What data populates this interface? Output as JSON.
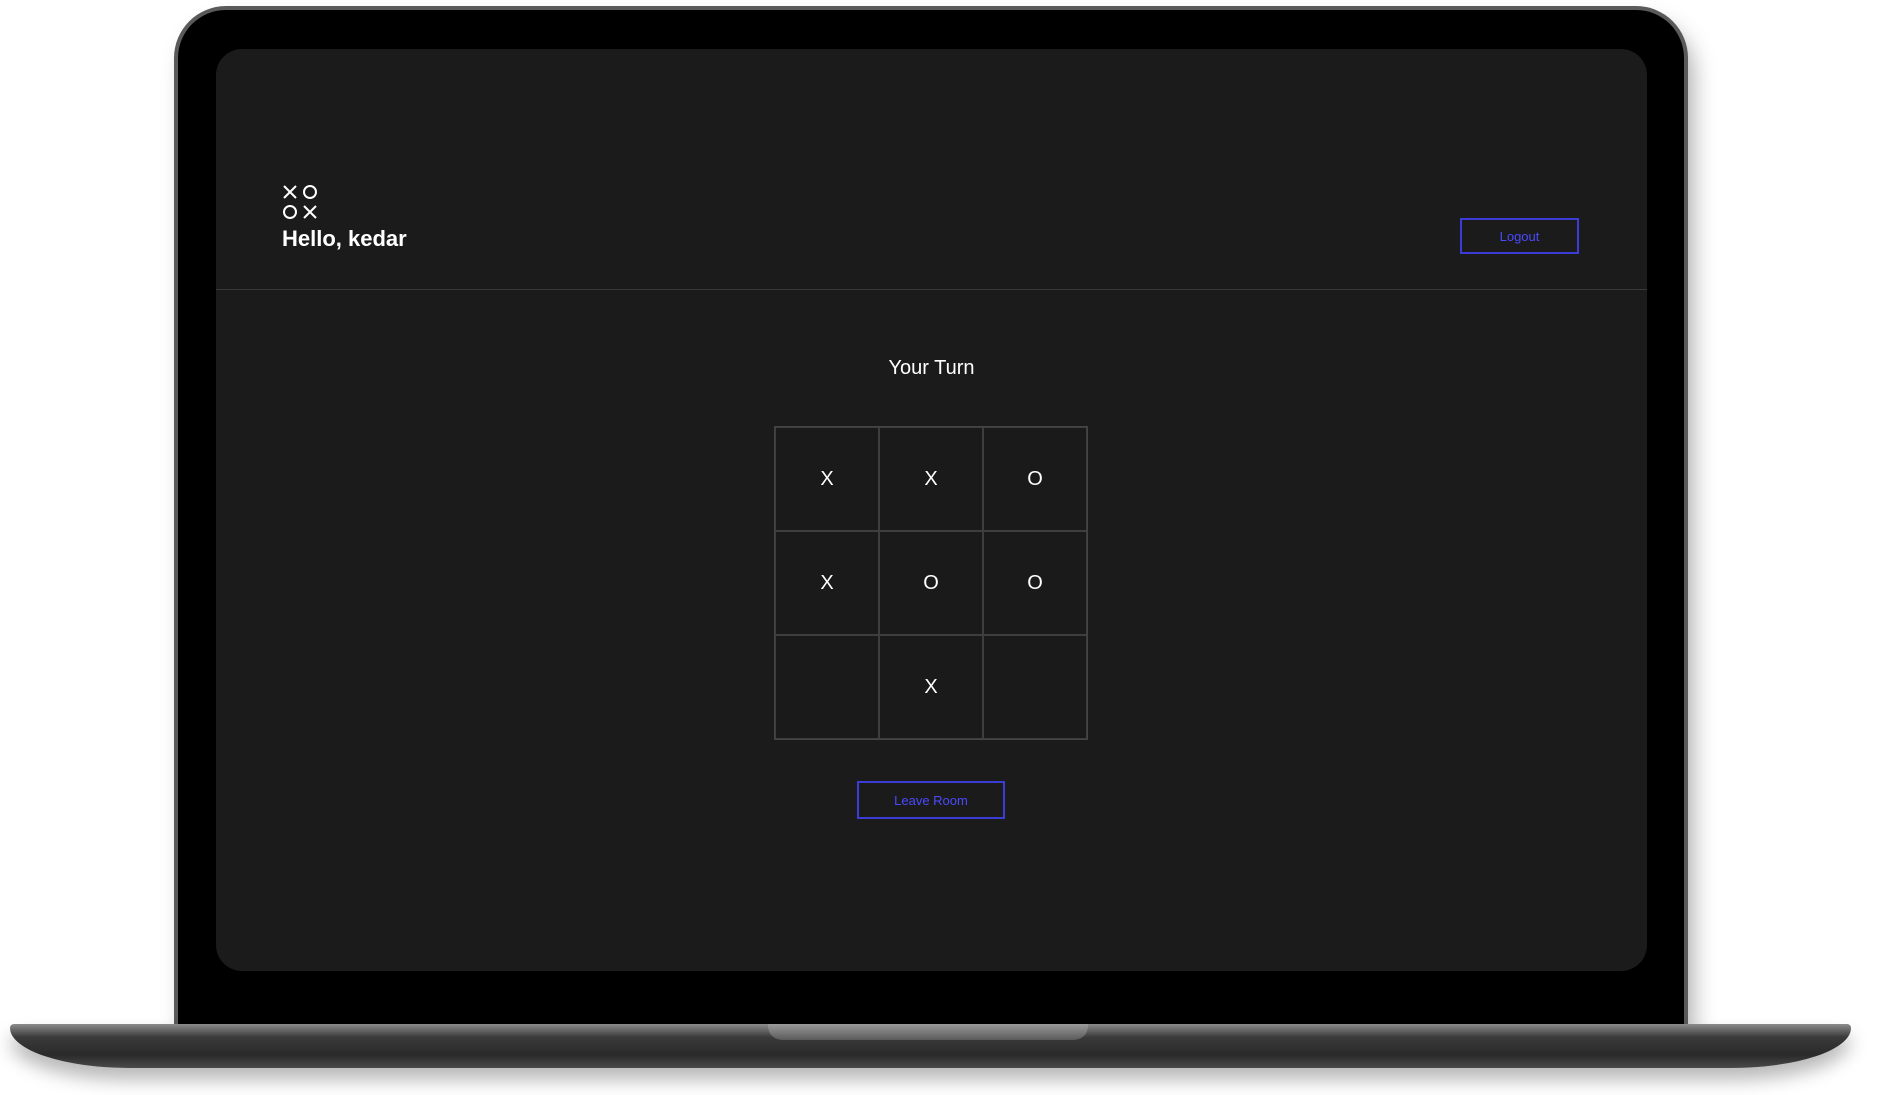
{
  "header": {
    "greeting": "Hello, kedar",
    "logout_label": "Logout",
    "logo_icon": "xo-logo-icon"
  },
  "game": {
    "turn_label": "Your Turn",
    "board": [
      "X",
      "X",
      "O",
      "X",
      "O",
      "O",
      "",
      "X",
      ""
    ],
    "leave_label": "Leave Room"
  },
  "colors": {
    "screen_bg": "#1b1b1b",
    "accent": "#3b3bd6",
    "text": "#ffffff",
    "grid_line": "#3e3e3e"
  }
}
